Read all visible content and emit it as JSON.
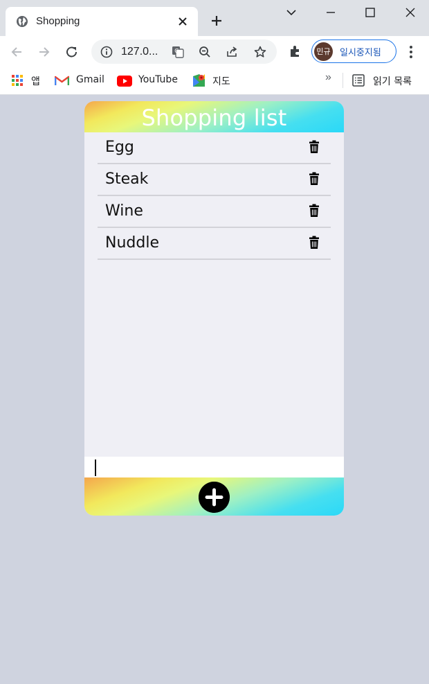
{
  "browser": {
    "tab_title": "Shopping",
    "url": "127.0...",
    "profile_initials": "민규",
    "profile_status": "일시중지됨"
  },
  "bookmarks": {
    "apps": "앱",
    "gmail": "Gmail",
    "youtube": "YouTube",
    "maps": "지도",
    "more": "»",
    "reading_list": "읽기 목록"
  },
  "app": {
    "title": "Shopping list",
    "items": [
      {
        "name": "Egg"
      },
      {
        "name": "Steak"
      },
      {
        "name": "Wine"
      },
      {
        "name": "Nuddle"
      }
    ],
    "input_value": "",
    "accent_colors": [
      "#f4a64c",
      "#f2e85c",
      "#46dff0"
    ]
  }
}
